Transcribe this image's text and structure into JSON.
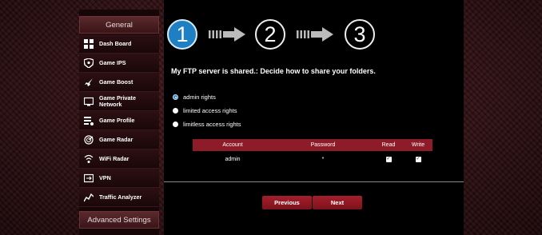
{
  "sidebar": {
    "general_header": "General",
    "advanced_header": "Advanced Settings",
    "items": [
      {
        "label": "Dash Board"
      },
      {
        "label": "Game IPS"
      },
      {
        "label": "Game Boost"
      },
      {
        "label": "Game Private Network"
      },
      {
        "label": "Game Profile"
      },
      {
        "label": "Game Radar"
      },
      {
        "label": "WiFi Radar"
      },
      {
        "label": "VPN"
      },
      {
        "label": "Traffic Analyzer"
      }
    ]
  },
  "wizard": {
    "steps": [
      "1",
      "2",
      "3"
    ],
    "active_step": 1,
    "heading": "My FTP server is shared.: Decide how to share your folders."
  },
  "options": [
    {
      "label": "admin rights",
      "selected": true
    },
    {
      "label": "limited access rights",
      "selected": false
    },
    {
      "label": "limitless access rights",
      "selected": false
    }
  ],
  "table": {
    "headers": {
      "account": "Account",
      "password": "Password",
      "read": "Read",
      "write": "Write"
    },
    "rows": [
      {
        "account": "admin",
        "password": "*",
        "read": true,
        "write": true
      }
    ]
  },
  "buttons": {
    "previous": "Previous",
    "next": "Next"
  },
  "colors": {
    "accent": "#8e1c28",
    "step_active": "#1f7fc3"
  }
}
